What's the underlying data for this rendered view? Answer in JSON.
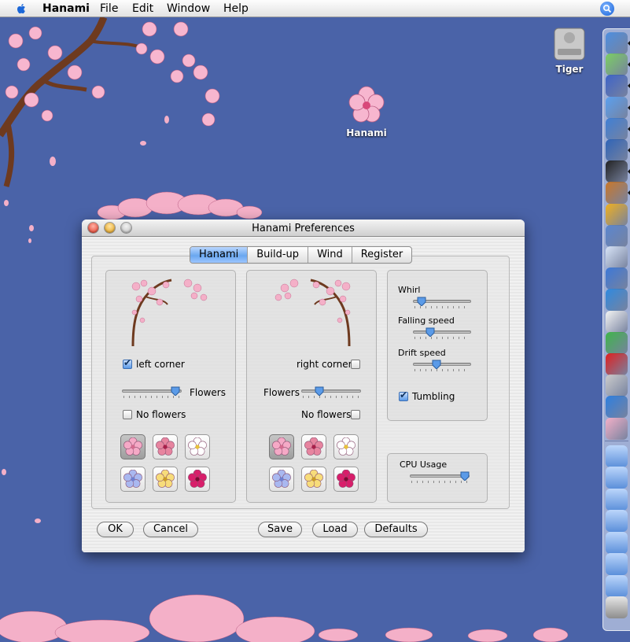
{
  "menubar": {
    "app": "Hanami",
    "items": [
      "File",
      "Edit",
      "Window",
      "Help"
    ]
  },
  "desktop": {
    "icons": [
      {
        "label": "Tiger",
        "icon": "hard-drive-icon"
      },
      {
        "label": "Hanami",
        "icon": "cherry-blossom-icon"
      }
    ]
  },
  "window": {
    "title": "Hanami Preferences",
    "tabs": [
      "Hanami",
      "Build-up",
      "Wind",
      "Register"
    ],
    "selected_tab": "Hanami",
    "left_panel": {
      "corner_label": "left corner",
      "corner_checked": true,
      "flowers_label": "Flowers",
      "flowers_value": 0.9,
      "no_flowers_label": "No flowers",
      "no_flowers_checked": false
    },
    "right_panel": {
      "corner_label": "right corner",
      "corner_checked": false,
      "flowers_label": "Flowers",
      "flowers_value": 0.3,
      "no_flowers_label": "No flowers",
      "no_flowers_checked": false
    },
    "motion": {
      "whirl_label": "Whirl",
      "whirl_value": 0.15,
      "falling_label": "Falling speed",
      "falling_value": 0.3,
      "drift_label": "Drift speed",
      "drift_value": 0.4,
      "tumbling_label": "Tumbling",
      "tumbling_checked": true
    },
    "cpu": {
      "label": "CPU Usage",
      "value": 0.92
    },
    "flower_colors": [
      "#f5a9c6",
      "#e7849f",
      "#ffffff",
      "#a9b8f0",
      "#f7dc7a",
      "#d81e6a"
    ],
    "flower_centers": [
      "#d46a8e",
      "#a8204a",
      "#e8c23a",
      "#6f7fd0",
      "#c99b25",
      "#7a0d33"
    ],
    "buttons": {
      "ok": "OK",
      "cancel": "Cancel",
      "save": "Save",
      "load": "Load",
      "defaults": "Defaults"
    }
  },
  "dock": {
    "apps": [
      "finder-icon",
      "itunes-icon",
      "mail-icon",
      "safari-icon",
      "ie-icon",
      "thunderbird-icon",
      "terminal-icon",
      "iphoto-icon",
      "sunflower-icon",
      "xcode-icon",
      "ical-icon",
      "preview-icon",
      "quicktime-icon",
      "textedit-icon",
      "ichat-icon",
      "cube-icon",
      "calculator-icon",
      "dp-icon",
      "hanami-icon"
    ],
    "stacks": [
      "home-folder-icon",
      "applications-folder-icon",
      "documents-folder-icon",
      "folder-icon",
      "pictures-folder-icon",
      "downloads-folder-icon",
      "desktop-folder-icon",
      "trash-icon"
    ]
  }
}
